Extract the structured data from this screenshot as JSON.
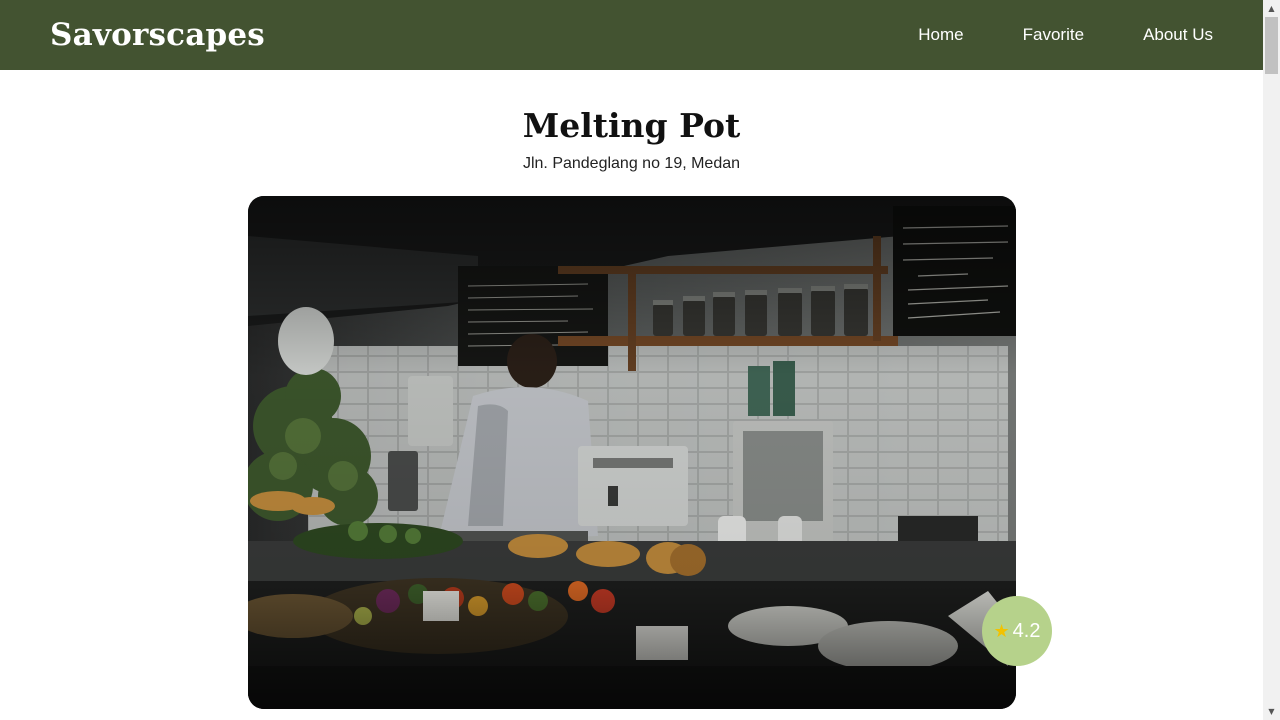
{
  "header": {
    "brand": "Savorscapes",
    "nav": [
      {
        "label": "Home"
      },
      {
        "label": "Favorite"
      },
      {
        "label": "About Us"
      }
    ]
  },
  "restaurant": {
    "name": "Melting Pot",
    "address": "Jln. Pandeglang no 19, Medan",
    "rating": "4.2",
    "image_alt": "Melting Pot"
  },
  "icons": {
    "rating": "star-icon"
  },
  "colors": {
    "header_bg": "#435331",
    "rating_bg": "#b6d28b",
    "star": "#f2c200"
  }
}
